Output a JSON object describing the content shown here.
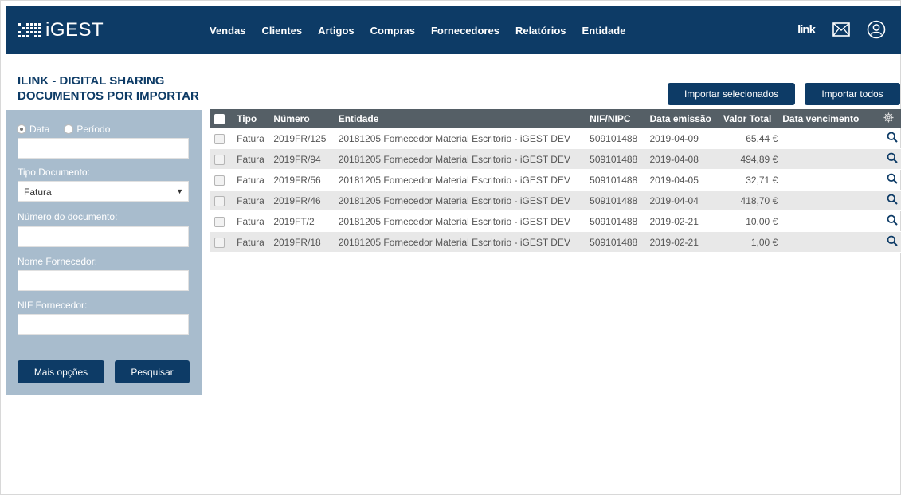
{
  "app": {
    "brand": "iGEST"
  },
  "nav": {
    "items": [
      "Vendas",
      "Clientes",
      "Artigos",
      "Compras",
      "Fornecedores",
      "Relatórios",
      "Entidade"
    ]
  },
  "topicons": {
    "link_text": "link",
    "mail": "mail-icon",
    "user": "user-icon"
  },
  "page": {
    "title_line1": "ILINK - DIGITAL SHARING",
    "title_line2": "DOCUMENTOS POR IMPORTAR"
  },
  "actions": {
    "import_selected": "Importar selecionados",
    "import_all": "Importar todos"
  },
  "filters": {
    "radio_date": "Data",
    "radio_period": "Período",
    "date_value": "",
    "doc_type_label": "Tipo Documento:",
    "doc_type_value": "Fatura",
    "doc_number_label": "Número do documento:",
    "supplier_name_label": "Nome Fornecedor:",
    "supplier_nif_label": "NIF Fornecedor:",
    "more_options": "Mais opções",
    "search": "Pesquisar"
  },
  "table": {
    "headers": [
      "Tipo",
      "Número",
      "Entidade",
      "NIF/NIPC",
      "Data emissão",
      "Valor Total",
      "Data vencimento"
    ],
    "rows": [
      {
        "tipo": "Fatura",
        "numero": "2019FR/125",
        "entidade": "20181205 Fornecedor Material Escritorio - iGEST DEV",
        "nif": "509101488",
        "emissao": "2019-04-09",
        "valor": "65,44 €",
        "vencimento": ""
      },
      {
        "tipo": "Fatura",
        "numero": "2019FR/94",
        "entidade": "20181205 Fornecedor Material Escritorio - iGEST DEV",
        "nif": "509101488",
        "emissao": "2019-04-08",
        "valor": "494,89 €",
        "vencimento": ""
      },
      {
        "tipo": "Fatura",
        "numero": "2019FR/56",
        "entidade": "20181205 Fornecedor Material Escritorio - iGEST DEV",
        "nif": "509101488",
        "emissao": "2019-04-05",
        "valor": "32,71 €",
        "vencimento": ""
      },
      {
        "tipo": "Fatura",
        "numero": "2019FR/46",
        "entidade": "20181205 Fornecedor Material Escritorio - iGEST DEV",
        "nif": "509101488",
        "emissao": "2019-04-04",
        "valor": "418,70 €",
        "vencimento": ""
      },
      {
        "tipo": "Fatura",
        "numero": "2019FT/2",
        "entidade": "20181205 Fornecedor Material Escritorio - iGEST DEV",
        "nif": "509101488",
        "emissao": "2019-02-21",
        "valor": "10,00 €",
        "vencimento": ""
      },
      {
        "tipo": "Fatura",
        "numero": "2019FR/18",
        "entidade": "20181205 Fornecedor Material Escritorio - iGEST DEV",
        "nif": "509101488",
        "emissao": "2019-02-21",
        "valor": "1,00 €",
        "vencimento": ""
      }
    ]
  },
  "colors": {
    "primary": "#0d3b66",
    "sidebar": "#a8bccd",
    "table_header": "#555f66",
    "row_alt": "#e8e8e8"
  }
}
